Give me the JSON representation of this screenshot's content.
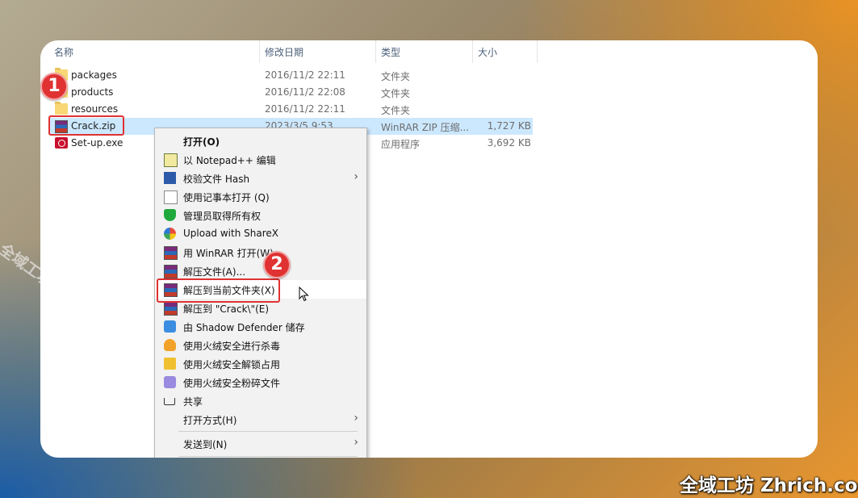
{
  "columns": {
    "name": "名称",
    "modified": "修改日期",
    "type": "类型",
    "size": "大小"
  },
  "files": [
    {
      "name": "packages",
      "modified": "2016/11/2 22:11",
      "type": "文件夹",
      "size": "",
      "icon": "folder-icon"
    },
    {
      "name": "products",
      "modified": "2016/11/2 22:08",
      "type": "文件夹",
      "size": "",
      "icon": "folder-icon"
    },
    {
      "name": "resources",
      "modified": "2016/11/2 22:11",
      "type": "文件夹",
      "size": "",
      "icon": "folder-icon"
    },
    {
      "name": "Crack.zip",
      "modified": "2023/3/5 9:53",
      "type": "WinRAR ZIP 压缩...",
      "size": "1,727 KB",
      "icon": "winrar-archive-icon",
      "selected": true
    },
    {
      "name": "Set-up.exe",
      "modified": "",
      "type": "应用程序",
      "size": "3,692 KB",
      "icon": "adobe-setup-icon"
    }
  ],
  "context_menu": {
    "items": [
      {
        "label": "打开(O)",
        "icon": "",
        "bold": true
      },
      {
        "label": "以 Notepad++ 编辑",
        "icon": "notepadpp-icon"
      },
      {
        "label": "校验文件 Hash",
        "icon": "powershell-icon",
        "submenu": true
      },
      {
        "label": "使用记事本打开 (Q)",
        "icon": "document-icon"
      },
      {
        "label": "管理员取得所有权",
        "icon": "shield-icon"
      },
      {
        "label": "Upload with ShareX",
        "icon": "sharex-icon"
      },
      {
        "label": "用 WinRAR 打开(W)",
        "icon": "winrar-icon"
      },
      {
        "label": "解压文件(A)...",
        "icon": "winrar-icon"
      },
      {
        "label": "解压到当前文件夹(X)",
        "icon": "winrar-icon",
        "hover": true
      },
      {
        "label": "解压到 \"Crack\\\"(E)",
        "icon": "winrar-icon"
      },
      {
        "label": "由 Shadow Defender 储存",
        "icon": "shadow-defender-icon"
      },
      {
        "label": "使用火绒安全进行杀毒",
        "icon": "huorong-icon"
      },
      {
        "label": "使用火绒安全解锁占用",
        "icon": "unlock-icon"
      },
      {
        "label": "使用火绒安全粉碎文件",
        "icon": "shredder-icon"
      },
      {
        "label": "共享",
        "icon": "share-icon"
      },
      {
        "label": "打开方式(H)",
        "icon": "",
        "submenu": true
      },
      {
        "label": "发送到(N)",
        "icon": "",
        "submenu": true
      }
    ]
  },
  "annotations": {
    "step1": "1",
    "step2": "2"
  },
  "watermark": {
    "diagonal": "全域工坊 zhrich.com",
    "corner": "全域工坊 Zhrich.com"
  },
  "colors": {
    "selection": "#cce8ff",
    "highlight_box": "#e03232",
    "menu_bg": "#f2f2f2"
  }
}
